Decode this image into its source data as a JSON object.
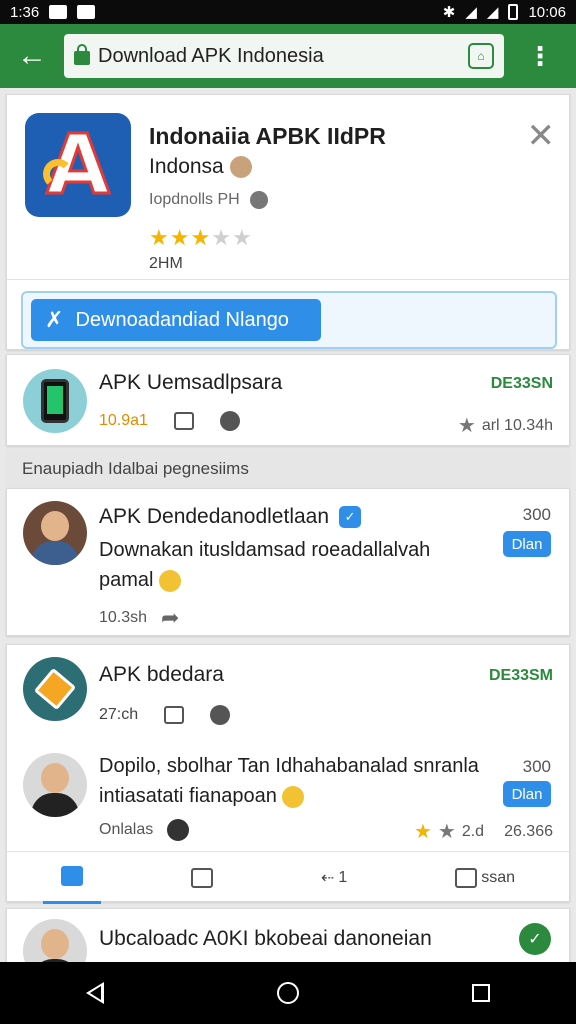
{
  "status": {
    "time_left": "1:36",
    "time_right": "10:06"
  },
  "browser": {
    "url": "Download APK Indonesia"
  },
  "app": {
    "title": "Indonaiia APBK IIdPR",
    "developer": "Indonsa",
    "size": "Iopdnolls PH",
    "rating_stars": 3,
    "rating_max": 5,
    "meta": "2HM",
    "download_label": "Dewnoadandiad Nlango"
  },
  "listing1": {
    "title": "APK Uemsadlpsara",
    "badge": "DE33SN",
    "count": "10.9a1",
    "meta_right": "arl 10.34h"
  },
  "section": {
    "label": "Enaupiadh Idalbai pegnesiims"
  },
  "comment1": {
    "title": "APK Dendedanodletlaan",
    "body": "Downakan itusldamsad roeadallalvah pamal",
    "count": "300",
    "pill": "Dlan",
    "meta": "10.3sh"
  },
  "listing2": {
    "title": "APK bdedara",
    "badge": "DE33SM",
    "count": "27:ch"
  },
  "comment2": {
    "body": "Dopilo, sbolhar Tan Idhahabanalad snranla intiasatati fianapoan",
    "count": "300",
    "pill": "Dlan",
    "meta": "Onlalas",
    "rating": "2.d",
    "meta_right": "26.366"
  },
  "action_bar": {
    "reply_count": "1",
    "more_label": "ssan"
  },
  "comment3": {
    "title": "Ubcaloadc A0KI bkobeai danoneian"
  }
}
